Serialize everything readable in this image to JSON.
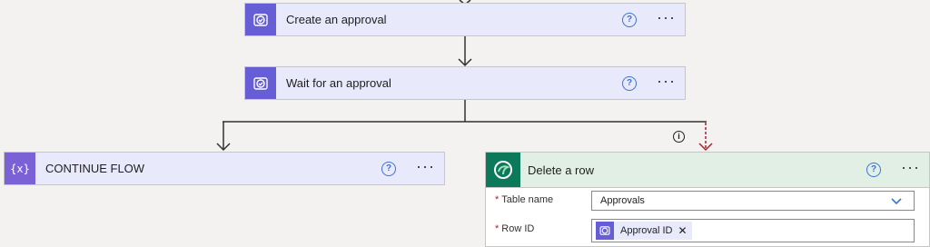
{
  "steps": {
    "create_approval": {
      "title": "Create an approval",
      "icon": "approval-icon"
    },
    "wait_approval": {
      "title": "Wait for an approval",
      "icon": "approval-icon"
    },
    "continue_flow": {
      "title": "CONTINUE FLOW",
      "icon": "variable-braces-icon"
    },
    "delete_row": {
      "title": "Delete a row",
      "icon": "dataverse-icon",
      "fields": {
        "table_name_label": "Table name",
        "table_name_value": "Approvals",
        "row_id_label": "Row ID",
        "row_id_token": "Approval ID"
      }
    }
  },
  "common": {
    "help_glyph": "?",
    "more_glyph": "···",
    "required_mark": "*",
    "info_glyph": "i",
    "remove_token_glyph": "✕"
  },
  "colors": {
    "approval_accent": "#665ed6",
    "dataverse_accent": "#0c7a5a",
    "connector_red": "#a4262c"
  }
}
